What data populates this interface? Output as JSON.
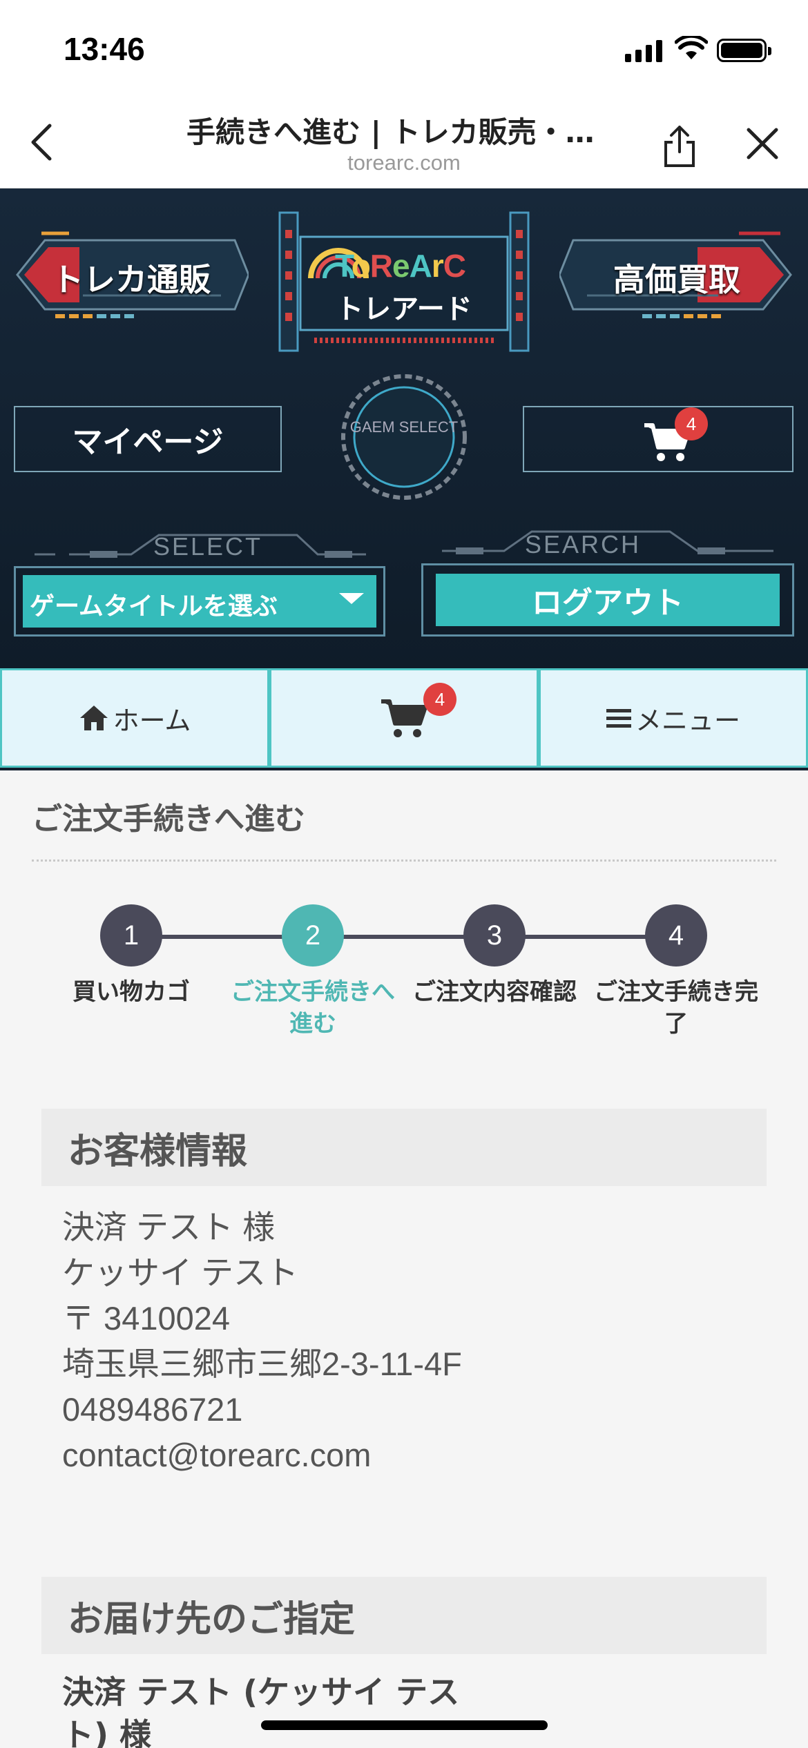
{
  "status_bar": {
    "time": "13:46"
  },
  "browser": {
    "title": "手続きへ進む | トレカ販売・…",
    "url": "torearc.com"
  },
  "header": {
    "left_banner": "トレカ通販",
    "right_banner": "高価買取",
    "logo_word": "ToReArC",
    "logo_sub": "トレアード",
    "mypage": "マイページ",
    "cart_count": "4",
    "game_select": "GAEM SELECT",
    "select_deco": "SELECT",
    "search_deco": "SEARCH",
    "game_title_select": "ゲームタイトルを選ぶ",
    "logout": "ログアウト"
  },
  "navbar": {
    "home": "ホーム",
    "cart_count": "4",
    "menu": "メニュー"
  },
  "main": {
    "section_title": "ご注文手続きへ進む",
    "steps": [
      {
        "num": "1",
        "label": "買い物カゴ"
      },
      {
        "num": "2",
        "label": "ご注文手続きへ進む"
      },
      {
        "num": "3",
        "label": "ご注文内容確認"
      },
      {
        "num": "4",
        "label": "ご注文手続き完了"
      }
    ],
    "customer_heading": "お客様情報",
    "customer": {
      "name": "決済 テスト 様",
      "kana": "ケッサイ テスト",
      "zip": "〒 3410024",
      "address": "埼玉県三郷市三郷2-3-11-4F",
      "phone": "0489486721",
      "email": "contact@torearc.com"
    },
    "destination_heading": "お届け先のご指定",
    "destination_name": "決済 テスト (ケッサイ テスト) 様"
  },
  "colors": {
    "accent": "#35bcbb",
    "dark_header": "#132030",
    "badge": "#e0403f"
  }
}
